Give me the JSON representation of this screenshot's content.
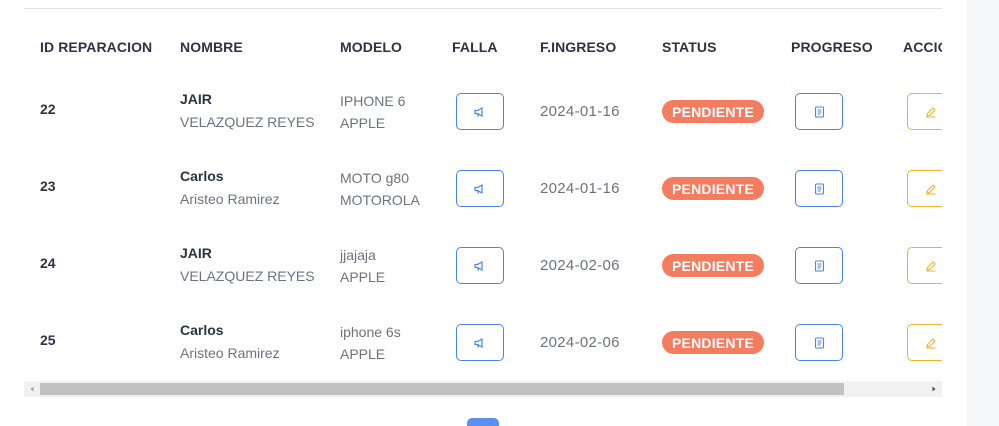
{
  "table": {
    "headers": [
      "ID REPARACION",
      "NOMBRE",
      "MODELO",
      "FALLA",
      "F.INGRESO",
      "STATUS",
      "PROGRESO",
      "ACCIONES"
    ],
    "rows": [
      {
        "id": "22",
        "name": "JAIR",
        "surname": "VELAZQUEZ REYES",
        "model": "IPHONE 6",
        "brand": "APPLE",
        "date": "2024-01-16",
        "status": "PENDIENTE"
      },
      {
        "id": "23",
        "name": "Carlos",
        "surname": "Aristeo Ramirez",
        "model": "MOTO g80",
        "brand": "MOTOROLA",
        "date": "2024-01-16",
        "status": "PENDIENTE"
      },
      {
        "id": "24",
        "name": "JAIR",
        "surname": "VELAZQUEZ REYES",
        "model": "jjajaja",
        "brand": "APPLE",
        "date": "2024-02-06",
        "status": "PENDIENTE"
      },
      {
        "id": "25",
        "name": "Carlos",
        "surname": "Aristeo Ramirez",
        "model": "iphone 6s",
        "brand": "APPLE",
        "date": "2024-02-06",
        "status": "PENDIENTE"
      }
    ]
  },
  "icons": {
    "falla": "megaphone-icon",
    "progreso": "document-icon",
    "acciones": "edit-icon"
  },
  "colors": {
    "status_pendiente": "#f47c5f",
    "primary_outline": "#4a86e0",
    "warning_outline": "#f0b429",
    "pagination_active": "#5b8ff0"
  },
  "pagination": {
    "current": ""
  }
}
